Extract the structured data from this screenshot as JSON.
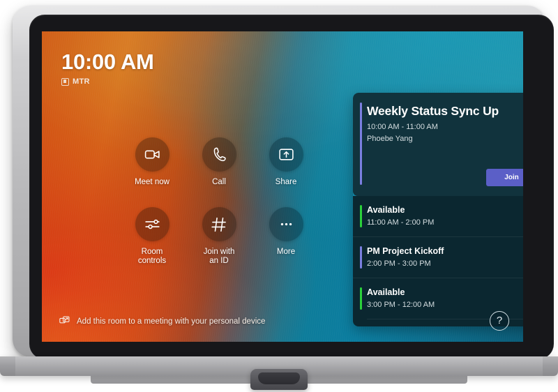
{
  "device": {
    "name": "teams-room-touch-console",
    "stand_label": ""
  },
  "screen": {
    "background": {
      "warm_color": "#d6761a",
      "cool_color": "#0e7c98"
    }
  },
  "clock": {
    "time": "10:00 AM",
    "badge_label": "MTR",
    "badge_icon": "mtr-badge-icon"
  },
  "actions": [
    {
      "id": "meet-now",
      "label": "Meet now",
      "icon": "video-camera-icon",
      "tone": "warm"
    },
    {
      "id": "call",
      "label": "Call",
      "icon": "phone-icon",
      "tone": "warm"
    },
    {
      "id": "share",
      "label": "Share",
      "icon": "share-screen-icon",
      "tone": "cool"
    },
    {
      "id": "room-controls",
      "label": "Room\ncontrols",
      "icon": "sliders-icon",
      "tone": "warm"
    },
    {
      "id": "join-with-id",
      "label": "Join with\nan ID",
      "icon": "hash-icon",
      "tone": "warm"
    },
    {
      "id": "more",
      "label": "More",
      "icon": "ellipsis-icon",
      "tone": "cool"
    }
  ],
  "meeting_card": {
    "title": "Weekly Status Sync Up",
    "time": "10:00 AM - 11:00 AM",
    "organizer": "Phoebe Yang",
    "join_label": "Join",
    "join_color": "#5b5fc7",
    "accent_color": "#7b7fe0",
    "provider_icon": "outlook-icon"
  },
  "agenda": {
    "items": [
      {
        "title": "Available",
        "time": "11:00 AM - 2:00 PM",
        "accent_color": "#2bd13a",
        "has_chevron": false,
        "chevron": ""
      },
      {
        "title": "PM Project Kickoff",
        "time": "2:00 PM - 3:00 PM",
        "accent_color": "#7b7fe0",
        "has_chevron": true,
        "chevron": "›"
      },
      {
        "title": "Available",
        "time": "3:00 PM - 12:00 AM",
        "accent_color": "#2bd13a",
        "has_chevron": false,
        "chevron": ""
      }
    ]
  },
  "bottom_bar": {
    "add_room_text": "Add this room to a meeting with your personal device",
    "add_room_icon": "cast-to-device-icon",
    "help_label": "?",
    "help_icon": "help-question-icon"
  }
}
